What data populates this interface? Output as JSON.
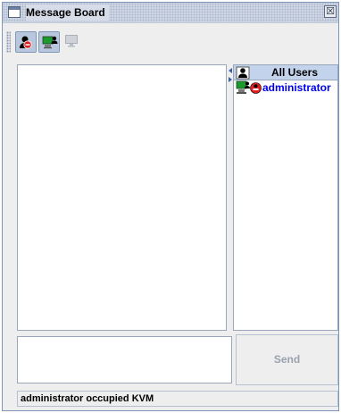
{
  "window": {
    "title": "Message Board",
    "close_glyph": "☒"
  },
  "toolbar": {
    "buttons": [
      {
        "icon": "user-occupied-icon",
        "state": "pressed"
      },
      {
        "icon": "user-computer-icon",
        "state": "pressed"
      },
      {
        "icon": "monitor-icon",
        "state": "disabled"
      }
    ]
  },
  "users_panel": {
    "header_label": "All Users",
    "users": [
      {
        "name": "administrator",
        "icons": [
          "computer-screen-icon",
          "user-occupied-icon"
        ]
      }
    ]
  },
  "message_input": {
    "value": ""
  },
  "send_button": {
    "label": "Send",
    "enabled": false
  },
  "status_bar": {
    "text": "administrator occupied KVM"
  },
  "colors": {
    "title_bar": "#d6dce8",
    "header_bg": "#c3d3ec",
    "user_link": "#0000ee",
    "window_bg": "#eeeeee",
    "occupied_red": "#e02020"
  }
}
